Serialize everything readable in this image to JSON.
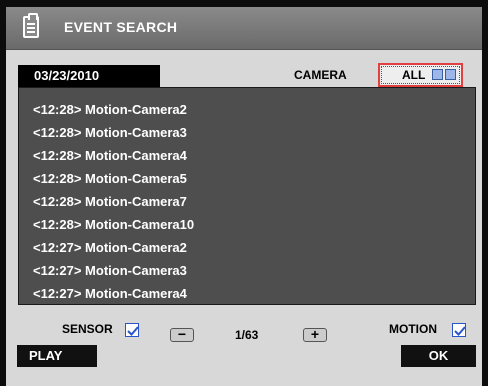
{
  "window": {
    "title": "EVENT SEARCH",
    "icon": "clipboard-icon"
  },
  "search": {
    "date": "03/23/2010",
    "camera_label": "CAMERA",
    "camera_value": "ALL"
  },
  "events": [
    "<12:28> Motion-Camera2",
    "<12:28> Motion-Camera3",
    "<12:28> Motion-Camera4",
    "<12:28> Motion-Camera5",
    "<12:28> Motion-Camera7",
    "<12:28> Motion-Camera10",
    "<12:27> Motion-Camera2",
    "<12:27> Motion-Camera3",
    "<12:27> Motion-Camera4"
  ],
  "filters": {
    "sensor_label": "SENSOR",
    "sensor_checked": true,
    "motion_label": "MOTION",
    "motion_checked": true
  },
  "pager": {
    "prev_symbol": "−",
    "page": "1/63",
    "next_symbol": "+"
  },
  "actions": {
    "play_label": "PLAY",
    "ok_label": "OK"
  },
  "colors": {
    "list_bg": "#4e4e4e",
    "highlight_border": "#e04040",
    "checkbox_blue": "#2a54c8"
  }
}
